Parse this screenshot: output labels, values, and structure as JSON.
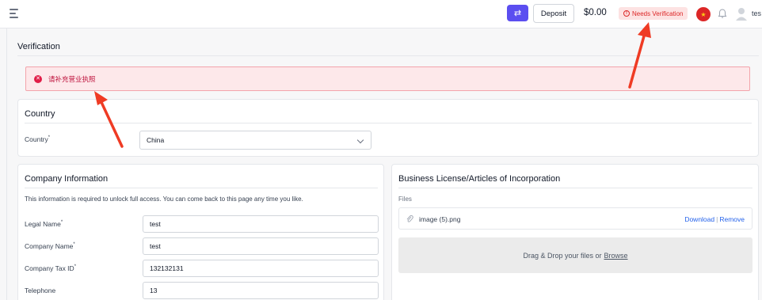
{
  "topbar": {
    "deposit_label": "Deposit",
    "balance": "$0.00",
    "needs_verification_label": "Needs Verification",
    "username": "tes",
    "accent_color": "#5b4ef0",
    "warning_color": "#dc2626"
  },
  "page": {
    "title": "Verification"
  },
  "alert": {
    "message": "请补充营业执照",
    "icon": "x-circle-icon"
  },
  "country_section": {
    "title": "Country",
    "label": "Country",
    "required_mark": "*",
    "selected": "China"
  },
  "company_section": {
    "title": "Company Information",
    "info": "This information is required to unlock full access. You can come back to this page any time you like.",
    "fields": [
      {
        "label": "Legal Name",
        "required": "*",
        "value": "test"
      },
      {
        "label": "Company Name",
        "required": "*",
        "value": "test"
      },
      {
        "label": "Company Tax ID",
        "required": "*",
        "value": "132132131"
      },
      {
        "label": "Telephone",
        "required": "",
        "value": "13"
      }
    ]
  },
  "license_section": {
    "title": "Business License/Articles of Incorporation",
    "files_label": "Files",
    "file_name": "image (5).png",
    "download_label": "Download",
    "separator": "|",
    "remove_label": "Remove",
    "dropzone_text": "Drag & Drop your files or",
    "browse_label": "Browse"
  },
  "icons": [
    "menu-icon",
    "swap-icon",
    "alert-circle-icon",
    "china-flag-icon",
    "bell-icon",
    "user-avatar-icon",
    "x-circle-icon",
    "chevron-down-icon",
    "paperclip-icon"
  ]
}
